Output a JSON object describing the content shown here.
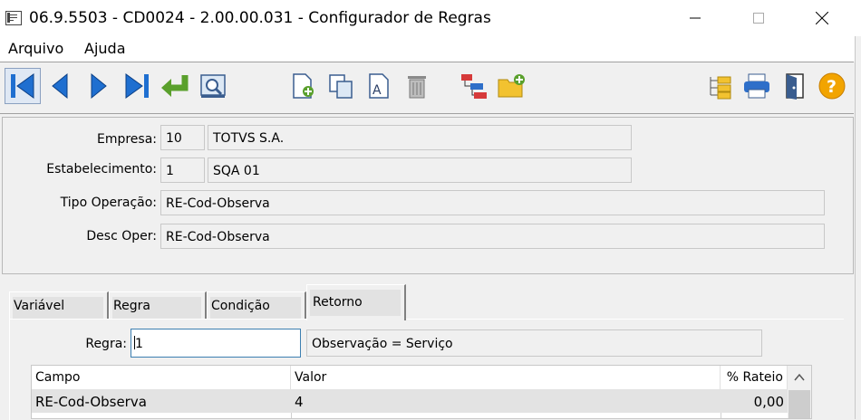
{
  "window": {
    "title": "06.9.5503 - CD0024 - 2.00.00.031 - Configurador de Regras",
    "icons": {
      "app": "app-window-icon",
      "minimize": "minimize-icon",
      "maximize": "maximize-icon",
      "close": "close-icon"
    }
  },
  "menu": {
    "items": [
      "Arquivo",
      "Ajuda"
    ]
  },
  "toolbar": {
    "buttons": [
      "first-record",
      "previous-record",
      "next-record",
      "last-record",
      "go-to",
      "search",
      "new-record",
      "copy-record",
      "edit-record",
      "delete-record",
      "hierarchy",
      "add-folder",
      "tree-structure",
      "print",
      "exit",
      "help"
    ]
  },
  "form": {
    "empresa": {
      "label": "Empresa:",
      "code": "10",
      "name": "TOTVS S.A."
    },
    "estabelecimento": {
      "label": "Estabelecimento:",
      "code": "1",
      "name": "SQA 01"
    },
    "tipo_operacao": {
      "label": "Tipo Operação:",
      "value": "RE-Cod-Observa"
    },
    "desc_oper": {
      "label": "Desc Oper:",
      "value": "RE-Cod-Observa"
    }
  },
  "tabs": [
    {
      "label": "Variável",
      "active": false
    },
    {
      "label": "Regra",
      "active": false
    },
    {
      "label": "Condição",
      "active": false
    },
    {
      "label": "Retorno",
      "active": true
    }
  ],
  "retorno": {
    "regra_label": "Regra:",
    "regra_value": "1",
    "regra_desc": "Observação = Serviço",
    "grid": {
      "columns": [
        "Campo",
        "Valor",
        "% Rateio"
      ],
      "rows": [
        {
          "campo": "RE-Cod-Observa",
          "valor": "4",
          "rateio": "0,00"
        }
      ]
    }
  },
  "colors": {
    "accent_blue": "#1f6fd0",
    "selection_bg": "#e3e3e3",
    "focus_border": "#3c7fb1"
  }
}
